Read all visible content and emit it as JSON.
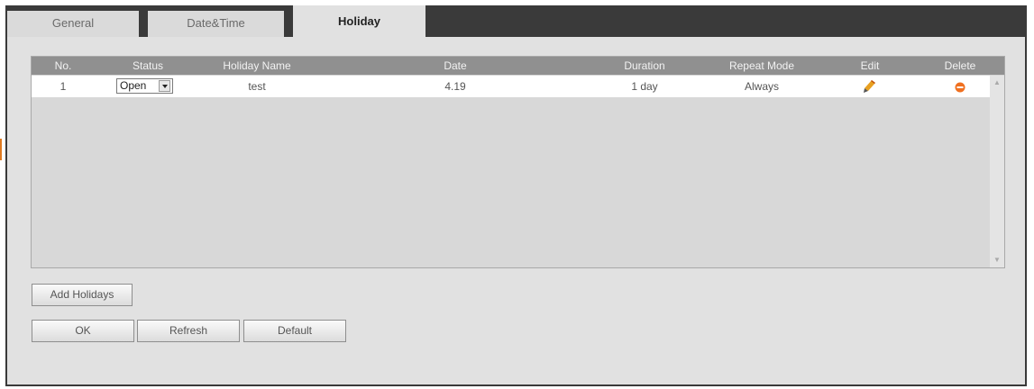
{
  "tabs": [
    {
      "label": "General",
      "active": false
    },
    {
      "label": "Date&Time",
      "active": false
    },
    {
      "label": "Holiday",
      "active": true
    }
  ],
  "table": {
    "headers": {
      "no": "No.",
      "status": "Status",
      "name": "Holiday Name",
      "date": "Date",
      "duration": "Duration",
      "repeat": "Repeat Mode",
      "edit": "Edit",
      "delete": "Delete"
    },
    "rows": [
      {
        "no": "1",
        "status": "Open",
        "name": "test",
        "date": "4.19",
        "duration": "1 day",
        "repeat": "Always",
        "edit_icon": "pencil-icon",
        "delete_icon": "delete-icon"
      }
    ]
  },
  "buttons": {
    "add": "Add Holidays",
    "ok": "OK",
    "refresh": "Refresh",
    "default": "Default"
  },
  "colors": {
    "tabbar": "#3a3a3a",
    "header": "#909090",
    "delete_icon": "#f07020",
    "edit_icon": "#e8a020"
  }
}
